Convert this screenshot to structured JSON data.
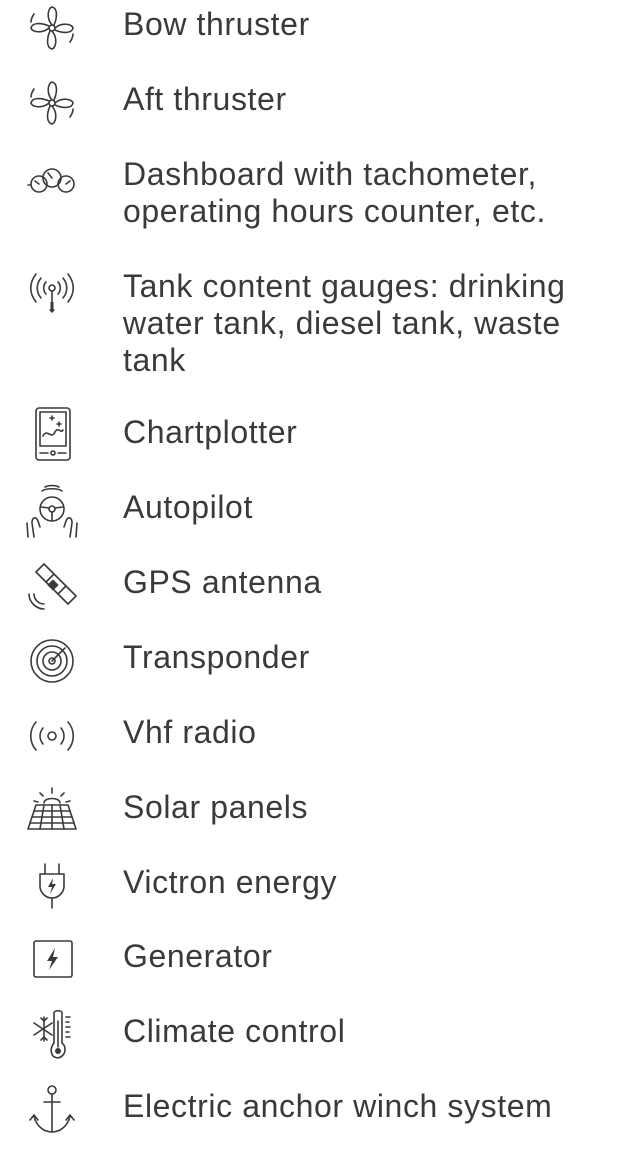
{
  "features": [
    {
      "label": "Bow thruster",
      "icon": "fan-icon"
    },
    {
      "label": "Aft thruster",
      "icon": "fan-icon"
    },
    {
      "label": "Dashboard with tachometer, operating hours counter, etc.",
      "icon": "gauges-icon"
    },
    {
      "label": "Tank content gauges: drinking water tank, diesel tank, waste tank",
      "icon": "sensor-signal-icon"
    },
    {
      "label": "Chartplotter",
      "icon": "chartplotter-icon"
    },
    {
      "label": "Autopilot",
      "icon": "steering-hands-icon"
    },
    {
      "label": "GPS antenna",
      "icon": "satellite-icon"
    },
    {
      "label": "Transponder",
      "icon": "radar-icon"
    },
    {
      "label": "Vhf radio",
      "icon": "radio-waves-icon"
    },
    {
      "label": "Solar panels",
      "icon": "solar-panel-icon"
    },
    {
      "label": "Victron energy",
      "icon": "plug-icon"
    },
    {
      "label": "Generator",
      "icon": "lightning-box-icon"
    },
    {
      "label": "Climate control",
      "icon": "thermometer-snowflake-icon"
    },
    {
      "label": "Electric anchor winch system",
      "icon": "anchor-icon"
    }
  ],
  "colors": {
    "text": "#3a3a3a",
    "icon": "#3a3a3a",
    "background": "#ffffff"
  }
}
